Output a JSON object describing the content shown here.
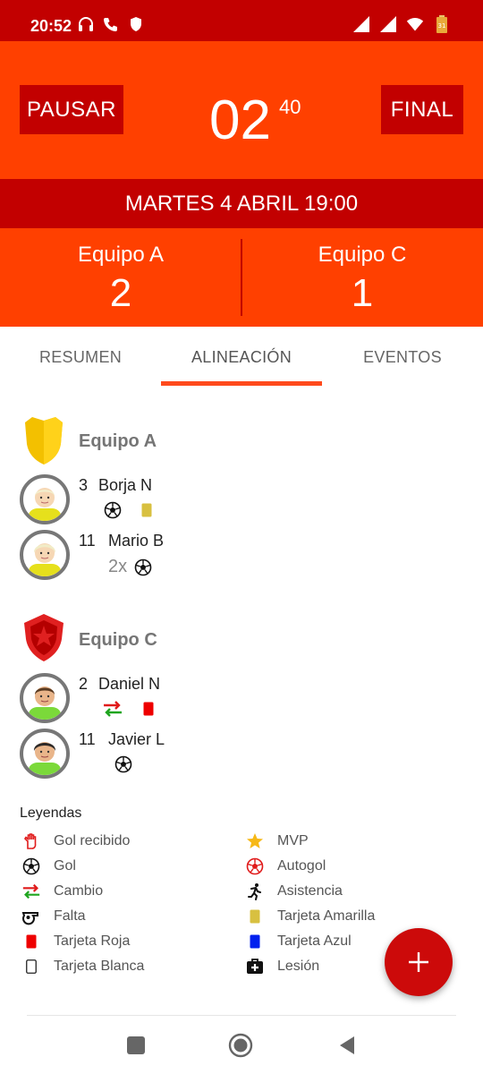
{
  "status_bar": {
    "time": "20:52",
    "icons_left": [
      "headphones-icon",
      "call-icon",
      "shield-icon"
    ],
    "icons_right": [
      "signal-icon",
      "signal-icon",
      "wifi-icon",
      "battery-icon"
    ]
  },
  "header": {
    "pause_label": "PAUSAR",
    "final_label": "FINAL",
    "timer_minutes": "02",
    "timer_seconds": "40",
    "date": "MARTES 4 ABRIL 19:00",
    "home": {
      "name": "Equipo A",
      "score": "2"
    },
    "away": {
      "name": "Equipo C",
      "score": "1"
    }
  },
  "tabs": [
    {
      "label": "RESUMEN"
    },
    {
      "label": "ALINEACIÓN",
      "active": true
    },
    {
      "label": "EVENTOS"
    }
  ],
  "lineup": {
    "team_a": {
      "name": "Equipo A",
      "players": [
        {
          "number": "3",
          "name": "Borja N",
          "events": [
            "ball-icon",
            "yellow-card-icon"
          ]
        },
        {
          "number": "11",
          "name": "Mario B",
          "count": "2x",
          "events": [
            "ball-icon"
          ]
        }
      ]
    },
    "team_c": {
      "name": "Equipo C",
      "players": [
        {
          "number": "2",
          "name": "Daniel N",
          "events": [
            "substitution-icon",
            "red-card-icon"
          ]
        },
        {
          "number": "11",
          "name": "Javier L",
          "events": [
            "ball-icon"
          ]
        }
      ]
    }
  },
  "legend": {
    "title": "Leyendas",
    "items": [
      {
        "label": "Gol recibido",
        "icon": "goalkeeper-glove-icon"
      },
      {
        "label": "MVP",
        "icon": "star-icon"
      },
      {
        "label": "Gol",
        "icon": "ball-icon"
      },
      {
        "label": "Autogol",
        "icon": "own-goal-ball-icon"
      },
      {
        "label": "Cambio",
        "icon": "substitution-icon"
      },
      {
        "label": "Asistencia",
        "icon": "runner-icon"
      },
      {
        "label": "Falta",
        "icon": "whistle-icon"
      },
      {
        "label": "Tarjeta Amarilla",
        "icon": "yellow-card-icon"
      },
      {
        "label": "Tarjeta Roja",
        "icon": "red-card-icon"
      },
      {
        "label": "Tarjeta Azul",
        "icon": "blue-card-icon"
      },
      {
        "label": "Tarjeta Blanca",
        "icon": "white-card-icon"
      },
      {
        "label": "Lesión",
        "icon": "medical-kit-icon"
      }
    ]
  },
  "fab": {
    "icon": "plus-icon"
  },
  "nav": {
    "icons": [
      "recents-icon",
      "home-icon",
      "back-icon"
    ]
  },
  "colors": {
    "primary": "#ff4000",
    "primary_dark": "#c20000",
    "tab_indicator": "#ff4a1c",
    "fab": "#cc0a0a",
    "yellow_card": "#d8c040",
    "red_card": "#ee0000",
    "blue_card": "#0020ee"
  }
}
